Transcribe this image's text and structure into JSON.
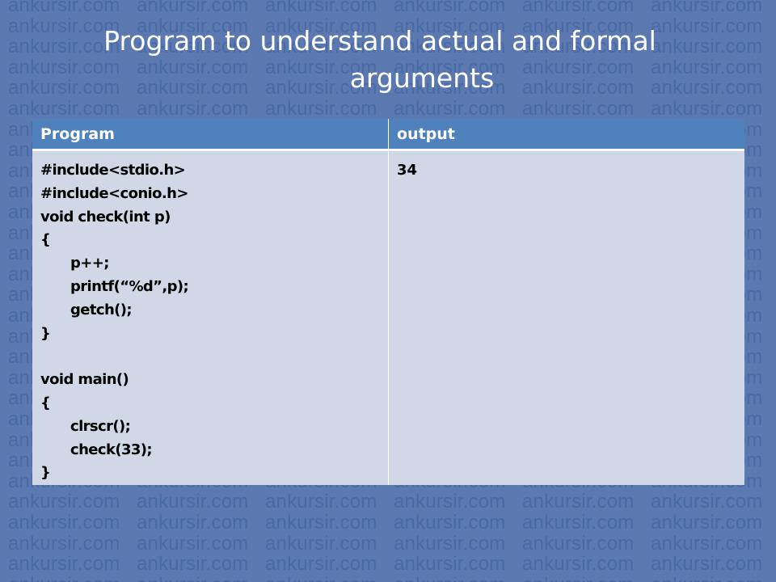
{
  "slide": {
    "title_line1": "Program to understand actual and formal",
    "title_line2": "arguments"
  },
  "watermark": {
    "text": "ankursir.com"
  },
  "table": {
    "headers": [
      "Program",
      "output"
    ],
    "program_lines": [
      "#include<stdio.h>",
      "#include<conio.h>",
      "void check(int p)",
      "{",
      "p++;",
      "printf(“%d”,p);",
      "getch();",
      "}",
      "",
      "void main()",
      "{",
      "clrscr();",
      "check(33);",
      "}"
    ],
    "output": "34"
  },
  "colors": {
    "background": "#5b79b0",
    "header_fill": "#4f81bd",
    "cell_fill": "#d0d8e8",
    "title_text": "#ffffff",
    "watermark_text": "#4a6aa6"
  }
}
